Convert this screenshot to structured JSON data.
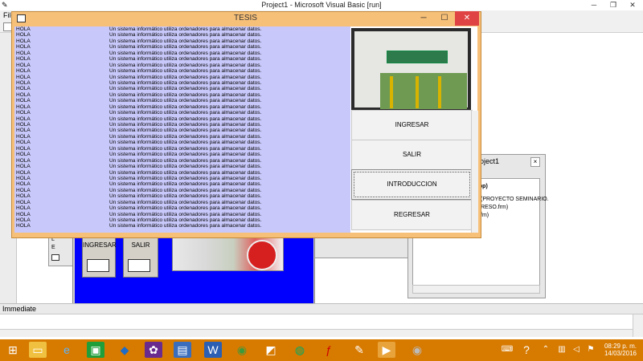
{
  "ide": {
    "title": "Project1 - Microsoft Visual Basic [run]",
    "menu_first": "File"
  },
  "tesis_form": {
    "title": "TESIS",
    "rows": [
      {
        "c1": "HOLA",
        "c2": "Un sistema informático utiliza ordenadores para almacenar datos."
      },
      {
        "c1": "HOLA",
        "c2": "Un sistema informático utiliza ordenadores para almacenar datos."
      },
      {
        "c1": "HOLA",
        "c2": "Un sistema informático utiliza ordenadores para almacenar datos."
      },
      {
        "c1": "HOLA",
        "c2": "Un sistema informático utiliza ordenadores para almacenar datos."
      },
      {
        "c1": "HOLA",
        "c2": "Un sistema informático utiliza ordenadores para almacenar datos."
      },
      {
        "c1": "HOLA",
        "c2": "Un sistema informático utiliza ordenadores para almacenar datos."
      },
      {
        "c1": "HOLA",
        "c2": "Un sistema informático utiliza ordenadores para almacenar datos."
      },
      {
        "c1": "HOLA",
        "c2": "Un sistema informático utiliza ordenadores para almacenar datos."
      },
      {
        "c1": "HOLA",
        "c2": "Un sistema informático utiliza ordenadores para almacenar datos."
      },
      {
        "c1": "HOLA",
        "c2": "Un sistema informático utiliza ordenadores para almacenar datos."
      },
      {
        "c1": "HOLA",
        "c2": "Un sistema informático utiliza ordenadores para almacenar datos."
      },
      {
        "c1": "HOLA",
        "c2": "Un sistema informático utiliza ordenadores para almacenar datos."
      },
      {
        "c1": "HOLA",
        "c2": "Un sistema informático utiliza ordenadores para almacenar datos."
      },
      {
        "c1": "HOLA",
        "c2": "Un sistema informático utiliza ordenadores para almacenar datos."
      },
      {
        "c1": "HOLA",
        "c2": "Un sistema informático utiliza ordenadores para almacenar datos."
      },
      {
        "c1": "HOLA",
        "c2": "Un sistema informático utiliza ordenadores para almacenar datos."
      },
      {
        "c1": "HOLA",
        "c2": "Un sistema informático utiliza ordenadores para almacenar datos."
      },
      {
        "c1": "HOLA",
        "c2": "Un sistema informático utiliza ordenadores para almacenar datos."
      },
      {
        "c1": "HOLA",
        "c2": "Un sistema informático utiliza ordenadores para almacenar datos."
      },
      {
        "c1": "HOLA",
        "c2": "Un sistema informático utiliza ordenadores para almacenar datos."
      },
      {
        "c1": "HOLA",
        "c2": "Un sistema informático utiliza ordenadores para almacenar datos."
      },
      {
        "c1": "HOLA",
        "c2": "Un sistema informático utiliza ordenadores para almacenar datos."
      },
      {
        "c1": "HOLA",
        "c2": "Un sistema informático utiliza ordenadores para almacenar datos."
      },
      {
        "c1": "HOLA",
        "c2": "Un sistema informático utiliza ordenadores para almacenar datos."
      },
      {
        "c1": "HOLA",
        "c2": "Un sistema informático utiliza ordenadores para almacenar datos."
      },
      {
        "c1": "HOLA",
        "c2": "Un sistema informático utiliza ordenadores para almacenar datos."
      },
      {
        "c1": "HOLA",
        "c2": "Un sistema informático utiliza ordenadores para almacenar datos."
      },
      {
        "c1": "HOLA",
        "c2": "Un sistema informático utiliza ordenadores para almacenar datos."
      },
      {
        "c1": "HOLA",
        "c2": "Un sistema informático utiliza ordenadores para almacenar datos."
      },
      {
        "c1": "HOLA",
        "c2": "Un sistema informático utiliza ordenadores para almacenar datos."
      },
      {
        "c1": "HOLA",
        "c2": "Un sistema informático utiliza ordenadores para almacenar datos."
      },
      {
        "c1": "HOLA",
        "c2": "Un sistema informático utiliza ordenadores para almacenar datos."
      },
      {
        "c1": "HOLA",
        "c2": "Un sistema informático utiliza ordenadores para almacenar datos."
      },
      {
        "c1": "HOLA",
        "c2": "Un sistema informático utiliza ordenadores para almacenar datos."
      }
    ],
    "buttons": {
      "ingresar": "INGRESAR",
      "salir": "SALIR",
      "introduccion": "INTRODUCCION",
      "regresar": "REGRESAR"
    }
  },
  "design_form": {
    "btn_ingresar": "INGRESAR",
    "btn_salir": "SALIR",
    "fragment_a": "L",
    "fragment_b": "E"
  },
  "project_window": {
    "title": "roject1",
    "tree": [
      "vbp)",
      "(PROYECTO SEMINARIO.",
      "RESO.frm)",
      "fm)"
    ]
  },
  "immediate": {
    "title": "Immediate"
  },
  "taskbar": {
    "time": "08:29 p. m.",
    "date": "14/03/2016"
  },
  "colors": {
    "tesis_bg": "#f7c079",
    "listbox_bg": "#c8c8fa",
    "design_form_blue": "#0000ff",
    "taskbar": "#d77a00",
    "close_red": "#e04343"
  }
}
